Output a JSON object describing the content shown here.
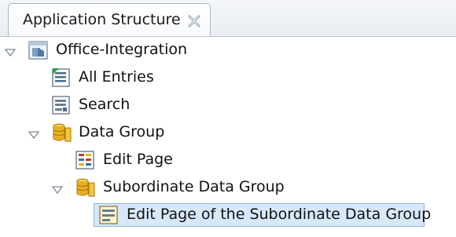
{
  "tab": {
    "title": "Application Structure",
    "close_icon": "close-icon"
  },
  "tree": {
    "root": {
      "label": "Office-Integration",
      "icon": "application-icon",
      "expanded": true
    },
    "items": [
      {
        "label": "All Entries",
        "icon": "list-page-icon"
      },
      {
        "label": "Search",
        "icon": "search-page-icon"
      },
      {
        "label": "Data Group",
        "icon": "data-group-icon",
        "expanded": true
      },
      {
        "label": "Edit Page",
        "icon": "edit-page-icon"
      },
      {
        "label": "Subordinate Data Group",
        "icon": "data-group-icon",
        "expanded": true
      },
      {
        "label": "Edit Page of the Subordinate Data Group",
        "icon": "edit-page-icon",
        "selected": true
      }
    ]
  },
  "colors": {
    "selection": "#d8e8fb",
    "selection_border": "#8fb3de",
    "database_gold": "#e8b020"
  }
}
